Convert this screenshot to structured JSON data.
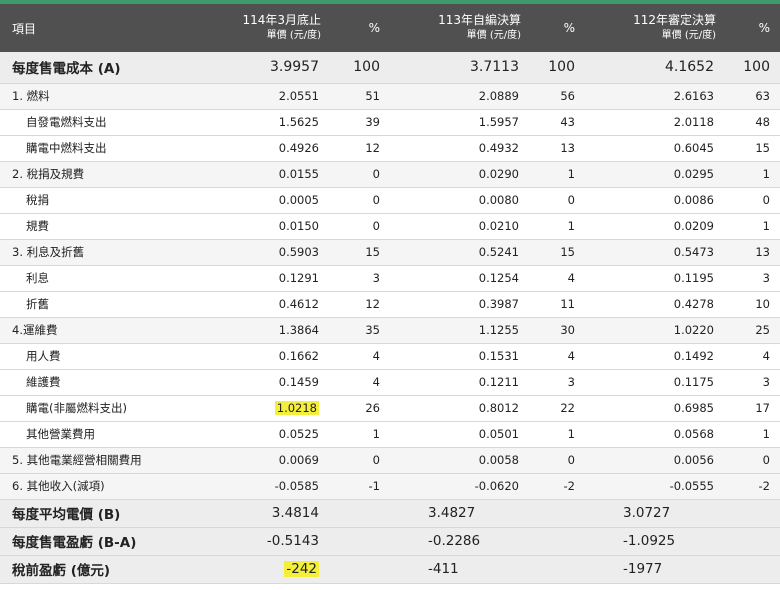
{
  "header": {
    "item_label": "項目",
    "col1_title": "114年3月底止",
    "col1_unit": "單價 (元/度)",
    "col2_title": "113年自編決算",
    "col2_unit": "單價 (元/度)",
    "col3_title": "112年審定決算",
    "col3_unit": "單價 (元/度)",
    "pct_label": "%"
  },
  "rows": [
    {
      "label": "每度售電成本 (A)",
      "v1": "3.9957",
      "p1": "100",
      "v2": "3.7113",
      "p2": "100",
      "v3": "4.1652",
      "p3": "100"
    },
    {
      "label": "1. 燃料",
      "v1": "2.0551",
      "p1": "51",
      "v2": "2.0889",
      "p2": "56",
      "v3": "2.6163",
      "p3": "63"
    },
    {
      "label": "自發電燃料支出",
      "v1": "1.5625",
      "p1": "39",
      "v2": "1.5957",
      "p2": "43",
      "v3": "2.0118",
      "p3": "48"
    },
    {
      "label": "購電中燃料支出",
      "v1": "0.4926",
      "p1": "12",
      "v2": "0.4932",
      "p2": "13",
      "v3": "0.6045",
      "p3": "15"
    },
    {
      "label": "2. 稅捐及規費",
      "v1": "0.0155",
      "p1": "0",
      "v2": "0.0290",
      "p2": "1",
      "v3": "0.0295",
      "p3": "1"
    },
    {
      "label": "稅捐",
      "v1": "0.0005",
      "p1": "0",
      "v2": "0.0080",
      "p2": "0",
      "v3": "0.0086",
      "p3": "0"
    },
    {
      "label": "規費",
      "v1": "0.0150",
      "p1": "0",
      "v2": "0.0210",
      "p2": "1",
      "v3": "0.0209",
      "p3": "1"
    },
    {
      "label": "3. 利息及折舊",
      "v1": "0.5903",
      "p1": "15",
      "v2": "0.5241",
      "p2": "15",
      "v3": "0.5473",
      "p3": "13"
    },
    {
      "label": "利息",
      "v1": "0.1291",
      "p1": "3",
      "v2": "0.1254",
      "p2": "4",
      "v3": "0.1195",
      "p3": "3"
    },
    {
      "label": "折舊",
      "v1": "0.4612",
      "p1": "12",
      "v2": "0.3987",
      "p2": "11",
      "v3": "0.4278",
      "p3": "10"
    },
    {
      "label": "4.運維費",
      "v1": "1.3864",
      "p1": "35",
      "v2": "1.1255",
      "p2": "30",
      "v3": "1.0220",
      "p3": "25"
    },
    {
      "label": "用人費",
      "v1": "0.1662",
      "p1": "4",
      "v2": "0.1531",
      "p2": "4",
      "v3": "0.1492",
      "p3": "4"
    },
    {
      "label": "維護費",
      "v1": "0.1459",
      "p1": "4",
      "v2": "0.1211",
      "p2": "3",
      "v3": "0.1175",
      "p3": "3"
    },
    {
      "label": "購電(非屬燃料支出)",
      "v1": "1.0218",
      "p1": "26",
      "v2": "0.8012",
      "p2": "22",
      "v3": "0.6985",
      "p3": "17"
    },
    {
      "label": "其他營業費用",
      "v1": "0.0525",
      "p1": "1",
      "v2": "0.0501",
      "p2": "1",
      "v3": "0.0568",
      "p3": "1"
    },
    {
      "label": "5. 其他電業經營相關費用",
      "v1": "0.0069",
      "p1": "0",
      "v2": "0.0058",
      "p2": "0",
      "v3": "0.0056",
      "p3": "0"
    },
    {
      "label": "6. 其他收入(減項)",
      "v1": "-0.0585",
      "p1": "-1",
      "v2": "-0.0620",
      "p2": "-2",
      "v3": "-0.0555",
      "p3": "-2"
    }
  ],
  "summary": [
    {
      "label": "每度平均電價 (B)",
      "v1": "3.4814",
      "v2": "3.4827",
      "v3": "3.0727"
    },
    {
      "label": "每度售電盈虧 (B-A)",
      "v1": "-0.5143",
      "v2": "-0.2286",
      "v3": "-1.0925"
    },
    {
      "label": "稅前盈虧 (億元)",
      "v1": "-242",
      "v2": "-411",
      "v3": "-1977"
    }
  ],
  "colors": {
    "header_bg": "#505050",
    "highlight": "#f3ef3a",
    "top_accent": "#3d9a6a"
  }
}
